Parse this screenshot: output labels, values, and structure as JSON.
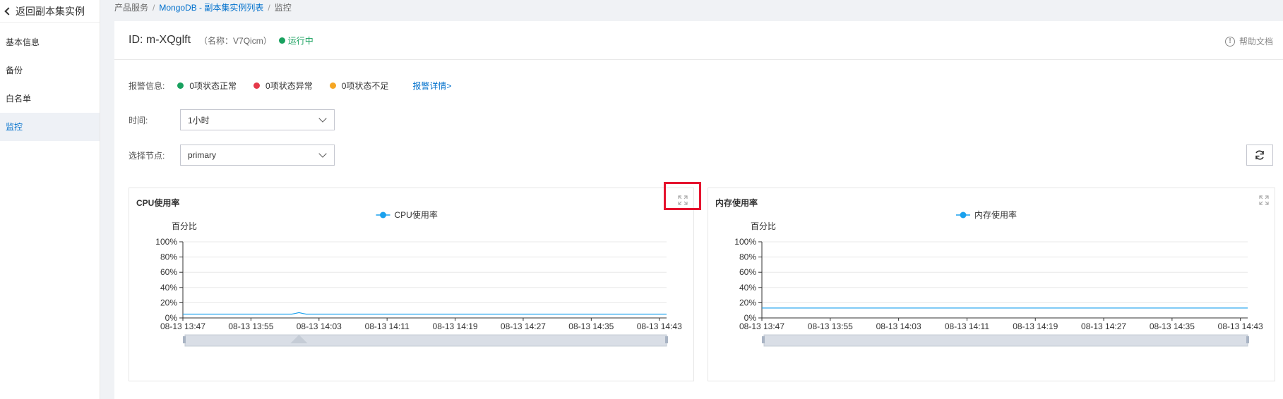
{
  "sidebar": {
    "back_label": "返回副本集实例",
    "items": [
      {
        "label": "基本信息"
      },
      {
        "label": "备份"
      },
      {
        "label": "白名单"
      },
      {
        "label": "监控"
      }
    ]
  },
  "breadcrumb": {
    "item1": "产品服务",
    "item2": "MongoDB - 副本集实例列表",
    "item3": "监控",
    "sep": "/"
  },
  "header": {
    "id": "ID: m-XQglft",
    "name": "（名称：V7Qicm）",
    "status": "运行中",
    "help": "帮助文档"
  },
  "alarm": {
    "label": "报警信息:",
    "normal": "0项状态正常",
    "abnormal": "0项状态异常",
    "insufficient": "0项状态不足",
    "details": "报警详情>",
    "colors": {
      "normal": "#19a15f",
      "abnormal": "#e5394a",
      "insufficient": "#f5a623"
    }
  },
  "filters": {
    "time_label": "时间:",
    "time_value": "1小时",
    "node_label": "选择节点:",
    "node_value": "primary"
  },
  "charts": [
    {
      "title": "CPU使用率",
      "legend": "CPU使用率",
      "ylabel": "百分比",
      "yticks": [
        "100%",
        "80%",
        "60%",
        "40%",
        "20%",
        "0%"
      ],
      "xticks": [
        "08-13 13:47",
        "08-13 13:55",
        "08-13 14:03",
        "08-13 14:11",
        "08-13 14:19",
        "08-13 14:27",
        "08-13 14:35",
        "08-13 14:43"
      ]
    },
    {
      "title": "内存使用率",
      "legend": "内存使用率",
      "ylabel": "百分比",
      "yticks": [
        "100%",
        "80%",
        "60%",
        "40%",
        "20%",
        "0%"
      ],
      "xticks": [
        "08-13 13:47",
        "08-13 13:55",
        "08-13 14:03",
        "08-13 14:11",
        "08-13 14:19",
        "08-13 14:27",
        "08-13 14:35",
        "08-13 14:43"
      ]
    }
  ],
  "chart_data": [
    {
      "type": "line",
      "title": "CPU使用率",
      "ylabel": "百分比",
      "ylim": [
        0,
        100
      ],
      "x": [
        "08-13 13:47",
        "08-13 13:55",
        "08-13 14:03",
        "08-13 14:11",
        "08-13 14:19",
        "08-13 14:27",
        "08-13 14:35",
        "08-13 14:43"
      ],
      "series": [
        {
          "name": "CPU使用率",
          "color": "#1aa1ee",
          "values": [
            5,
            5,
            5,
            5,
            5,
            5,
            5,
            5
          ]
        }
      ],
      "spike": {
        "x": "08-13 14:00",
        "value": 7
      },
      "legend": "top-center",
      "grid": true
    },
    {
      "type": "line",
      "title": "内存使用率",
      "ylabel": "百分比",
      "ylim": [
        0,
        100
      ],
      "x": [
        "08-13 13:47",
        "08-13 13:55",
        "08-13 14:03",
        "08-13 14:11",
        "08-13 14:19",
        "08-13 14:27",
        "08-13 14:35",
        "08-13 14:43"
      ],
      "series": [
        {
          "name": "内存使用率",
          "color": "#1aa1ee",
          "values": [
            13,
            13,
            13,
            13,
            13,
            13,
            13,
            13
          ]
        }
      ],
      "legend": "top-center",
      "grid": true
    }
  ]
}
